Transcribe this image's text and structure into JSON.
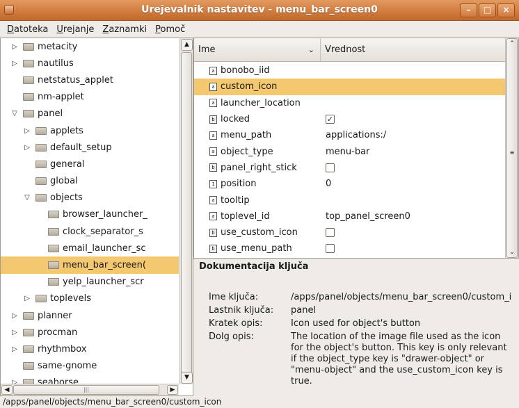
{
  "window": {
    "title": "Urejevalnik nastavitev - menu_bar_screen0"
  },
  "menubar": [
    {
      "label": "Datoteka",
      "accel": "D",
      "rest": "atoteka"
    },
    {
      "label": "Urejanje",
      "accel": "U",
      "rest": "rejanje"
    },
    {
      "label": "Zaznamki",
      "accel": "Z",
      "rest": "aznamki"
    },
    {
      "label": "Pomoč",
      "accel": "P",
      "rest": "omoč"
    }
  ],
  "tree": [
    {
      "label": "metacity",
      "level": 1,
      "expander": "▷",
      "selected": false
    },
    {
      "label": "nautilus",
      "level": 1,
      "expander": "▷",
      "selected": false
    },
    {
      "label": "netstatus_applet",
      "level": 1,
      "expander": "",
      "selected": false
    },
    {
      "label": "nm-applet",
      "level": 1,
      "expander": "",
      "selected": false
    },
    {
      "label": "panel",
      "level": 1,
      "expander": "▽",
      "selected": false
    },
    {
      "label": "applets",
      "level": 2,
      "expander": "▷",
      "selected": false
    },
    {
      "label": "default_setup",
      "level": 2,
      "expander": "▷",
      "selected": false
    },
    {
      "label": "general",
      "level": 2,
      "expander": "",
      "selected": false
    },
    {
      "label": "global",
      "level": 2,
      "expander": "",
      "selected": false
    },
    {
      "label": "objects",
      "level": 2,
      "expander": "▽",
      "selected": false
    },
    {
      "label": "browser_launcher_",
      "level": 3,
      "expander": "",
      "selected": false
    },
    {
      "label": "clock_separator_s",
      "level": 3,
      "expander": "",
      "selected": false
    },
    {
      "label": "email_launcher_sc",
      "level": 3,
      "expander": "",
      "selected": false
    },
    {
      "label": "menu_bar_screen(",
      "level": 3,
      "expander": "",
      "selected": true
    },
    {
      "label": "yelp_launcher_scr",
      "level": 3,
      "expander": "",
      "selected": false
    },
    {
      "label": "toplevels",
      "level": 2,
      "expander": "▷",
      "selected": false
    },
    {
      "label": "planner",
      "level": 1,
      "expander": "▷",
      "selected": false
    },
    {
      "label": "procman",
      "level": 1,
      "expander": "▷",
      "selected": false
    },
    {
      "label": "rhythmbox",
      "level": 1,
      "expander": "▷",
      "selected": false
    },
    {
      "label": "same-gnome",
      "level": 1,
      "expander": "",
      "selected": false
    },
    {
      "label": "seahorse",
      "level": 1,
      "expander": "▷",
      "selected": false
    }
  ],
  "keys_header": {
    "name": "Ime",
    "value": "Vrednost"
  },
  "keys": [
    {
      "name": "bonobo_iid",
      "type": "a",
      "value": "",
      "checkbox": null,
      "selected": false
    },
    {
      "name": "custom_icon",
      "type": "a",
      "value": "",
      "checkbox": null,
      "selected": true
    },
    {
      "name": "launcher_location",
      "type": "a",
      "value": "",
      "checkbox": null,
      "selected": false
    },
    {
      "name": "locked",
      "type": "b",
      "value": "",
      "checkbox": true,
      "selected": false
    },
    {
      "name": "menu_path",
      "type": "a",
      "value": "applications:/",
      "checkbox": null,
      "selected": false
    },
    {
      "name": "object_type",
      "type": "a",
      "value": "menu-bar",
      "checkbox": null,
      "selected": false
    },
    {
      "name": "panel_right_stick",
      "type": "b",
      "value": "",
      "checkbox": false,
      "selected": false
    },
    {
      "name": "position",
      "type": "1",
      "value": "0",
      "checkbox": null,
      "selected": false
    },
    {
      "name": "tooltip",
      "type": "a",
      "value": "",
      "checkbox": null,
      "selected": false
    },
    {
      "name": "toplevel_id",
      "type": "a",
      "value": "top_panel_screen0",
      "checkbox": null,
      "selected": false
    },
    {
      "name": "use_custom_icon",
      "type": "b",
      "value": "",
      "checkbox": false,
      "selected": false
    },
    {
      "name": "use_menu_path",
      "type": "b",
      "value": "",
      "checkbox": false,
      "selected": false
    }
  ],
  "doc": {
    "title": "Dokumentacija ključa",
    "key_name_label": "Ime ključa:",
    "key_name_value": "/apps/panel/objects/menu_bar_screen0/custom_i",
    "owner_label": "Lastnik ključa:",
    "owner_value": "panel",
    "short_label": "Kratek opis:",
    "short_value": "Icon used for object's button",
    "long_label": "Dolg opis:",
    "long_value": "The location of the image file used as the icon for the object's button. This key is only relevant if the object_type key is \"drawer-object\" or \"menu-object\" and the use_custom_icon key is true."
  },
  "statusbar": {
    "path": "/apps/panel/objects/menu_bar_screen0/custom_icon"
  }
}
